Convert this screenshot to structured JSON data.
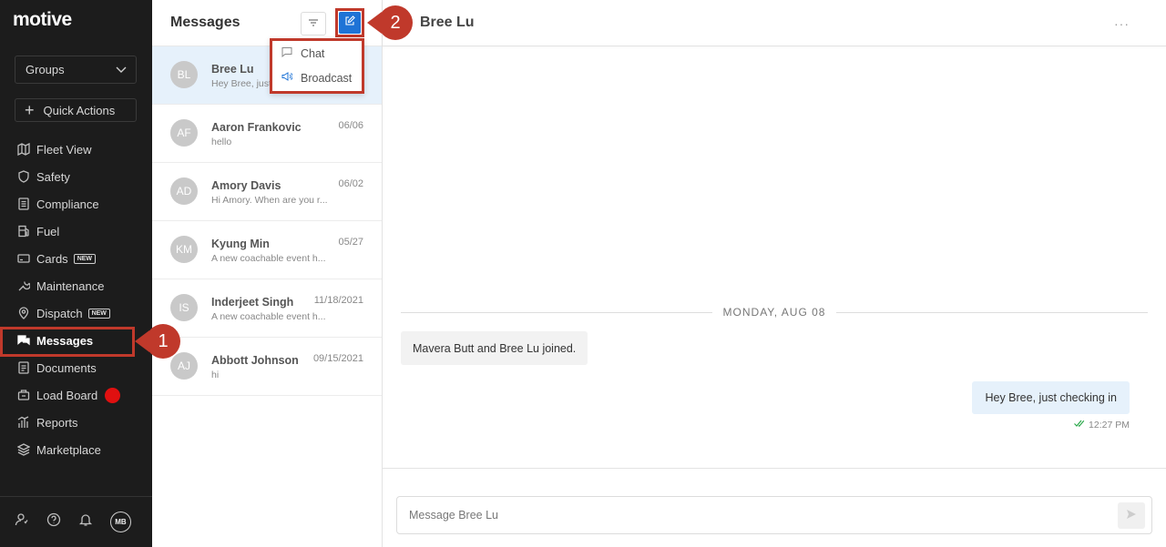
{
  "sidebar": {
    "logo": "motive",
    "groups_label": "Groups",
    "quick_actions_label": "Quick Actions",
    "items": [
      {
        "label": "Fleet View",
        "icon": "map-icon"
      },
      {
        "label": "Safety",
        "icon": "shield-icon"
      },
      {
        "label": "Compliance",
        "icon": "document-list-icon"
      },
      {
        "label": "Fuel",
        "icon": "fuel-pump-icon"
      },
      {
        "label": "Cards",
        "icon": "card-icon",
        "badge": "NEW"
      },
      {
        "label": "Maintenance",
        "icon": "wrench-icon"
      },
      {
        "label": "Dispatch",
        "icon": "location-pin-icon",
        "badge": "NEW"
      },
      {
        "label": "Messages",
        "icon": "chat-bubbles-icon",
        "active": true
      },
      {
        "label": "Documents",
        "icon": "file-icon"
      },
      {
        "label": "Load Board",
        "icon": "truck-load-icon"
      },
      {
        "label": "Reports",
        "icon": "bar-chart-icon"
      },
      {
        "label": "Marketplace",
        "icon": "layers-icon"
      }
    ],
    "user_initials": "MB"
  },
  "messages": {
    "title": "Messages",
    "compose_menu": {
      "chat_label": "Chat",
      "broadcast_label": "Broadcast"
    },
    "conversations": [
      {
        "initials": "BL",
        "name": "Bree Lu",
        "preview": "Hey Bree, just checking in",
        "date": ""
      },
      {
        "initials": "AF",
        "name": "Aaron Frankovic",
        "preview": "hello",
        "date": "06/06"
      },
      {
        "initials": "AD",
        "name": "Amory Davis",
        "preview": "Hi Amory. When are you r...",
        "date": "06/02"
      },
      {
        "initials": "KM",
        "name": "Kyung Min",
        "preview": "A new coachable event h...",
        "date": "05/27"
      },
      {
        "initials": "IS",
        "name": "Inderjeet Singh",
        "preview": "A new coachable event h...",
        "date": "11/18/2021"
      },
      {
        "initials": "AJ",
        "name": "Abbott Johnson",
        "preview": "hi",
        "date": "09/15/2021"
      }
    ]
  },
  "chat": {
    "title": "Bree Lu",
    "more_label": "···",
    "date_separator": "MONDAY, AUG 08",
    "system_message": "Mavera Butt and Bree Lu joined.",
    "outgoing_message": "Hey Bree, just checking in",
    "outgoing_time": "12:27 PM",
    "input_placeholder": "Message Bree Lu"
  },
  "callouts": {
    "step1": "1",
    "step2": "2"
  },
  "colors": {
    "accent": "#1e73d6",
    "callout": "#c0392b",
    "sidebar_bg": "#1c1c1c",
    "selected_bg": "#e6f1fb"
  }
}
